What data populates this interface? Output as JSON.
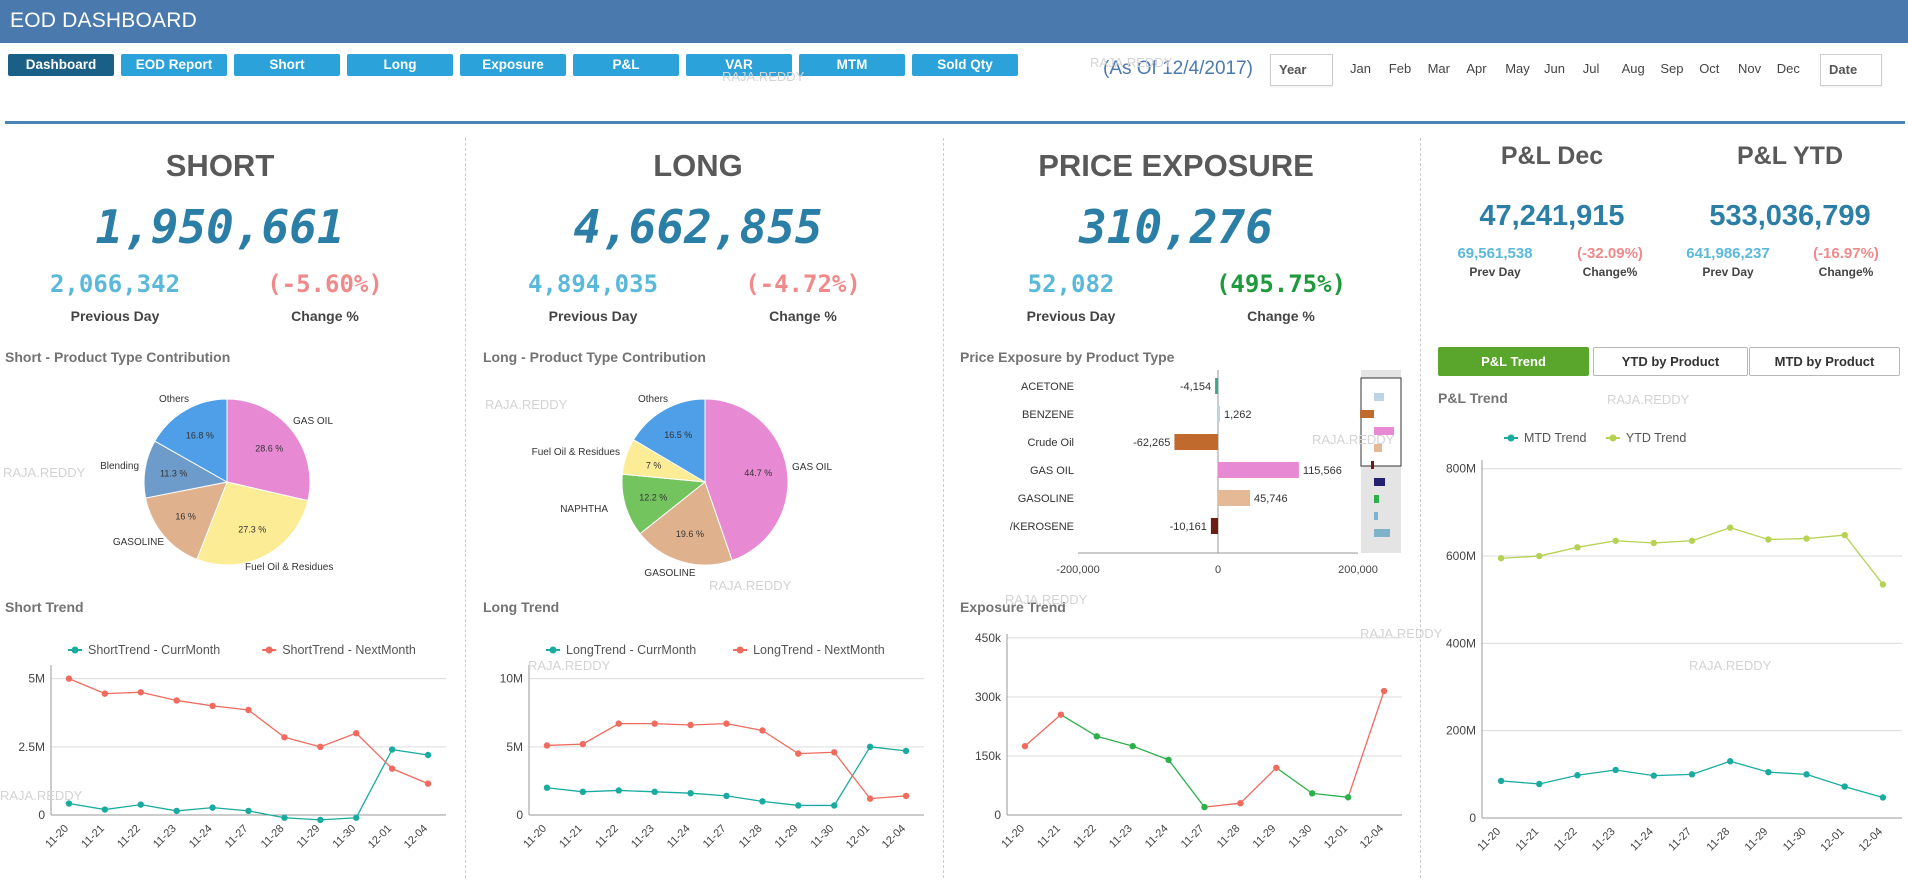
{
  "app": {
    "title": "EOD DASHBOARD"
  },
  "nav": [
    {
      "label": "Dashboard",
      "active": true
    },
    {
      "label": "EOD Report"
    },
    {
      "label": "Short"
    },
    {
      "label": "Long"
    },
    {
      "label": "Exposure"
    },
    {
      "label": "P&L"
    },
    {
      "label": "VAR"
    },
    {
      "label": "MTM"
    },
    {
      "label": "Sold Qty"
    }
  ],
  "asof": "(As Of 12/4/2017)",
  "filters": {
    "year_label": "Year",
    "date_label": "Date",
    "months": [
      "Jan",
      "Feb",
      "Mar",
      "Apr",
      "May",
      "Jun",
      "Jul",
      "Aug",
      "Sep",
      "Oct",
      "Nov",
      "Dec"
    ]
  },
  "watermark": "RAJA.REDDY",
  "kpis": {
    "short": {
      "title": "SHORT",
      "value": "1,950,661",
      "prev": "2,066,342",
      "prev_label": "Previous Day",
      "change": "(-5.60%)",
      "change_label": "Change %",
      "change_color": "#f08a8a"
    },
    "long": {
      "title": "LONG",
      "value": "4,662,855",
      "prev": "4,894,035",
      "prev_label": "Previous Day",
      "change": "(-4.72%)",
      "change_label": "Change %",
      "change_color": "#f08a8a"
    },
    "exposure": {
      "title": "PRICE EXPOSURE",
      "value": "310,276",
      "prev": "52,082",
      "prev_label": "Previous Day",
      "change": "(495.75%)",
      "change_label": "Change %",
      "change_color": "#1e9a3c"
    },
    "pl_dec": {
      "title": "P&L Dec",
      "value": "47,241,915",
      "prev": "69,561,538",
      "prev_label": "Prev Day",
      "change": "(-32.09%)",
      "change_label": "Change%",
      "change_color": "#f08a8a"
    },
    "pl_ytd": {
      "title": "P&L YTD",
      "value": "533,036,799",
      "prev": "641,986,237",
      "prev_label": "Prev Day",
      "change": "(-16.97%)",
      "change_label": "Change%",
      "change_color": "#f08a8a"
    }
  },
  "sections": {
    "short_pie": "Short - Product Type Contribution",
    "long_pie": "Long - Product Type Contribution",
    "exposure_bar": "Price Exposure by Product Type",
    "short_trend": "Short Trend",
    "long_trend": "Long Trend",
    "exposure_trend": "Exposure Trend",
    "pl_trend": "P&L Trend"
  },
  "pl_tabs": [
    {
      "label": "P&L Trend",
      "active": true
    },
    {
      "label": "YTD by Product"
    },
    {
      "label": "MTD by Product"
    }
  ],
  "colors": {
    "teal": "#1aaba0",
    "salmon": "#f06b5e",
    "green": "#2bb04a",
    "lime": "#b5d253",
    "kpi_blue": "#2b7ea5",
    "light_blue": "#5ab9da"
  },
  "chart_data": [
    {
      "id": "short_pie",
      "type": "pie",
      "slices": [
        {
          "label": "GAS OIL",
          "value": 28.6,
          "pct_label": "28.6 %",
          "color": "#e88ad3"
        },
        {
          "label": "Fuel Oil & Residues",
          "value": 27.3,
          "pct_label": "27.3 %",
          "color": "#fdec96"
        },
        {
          "label": "GASOLINE",
          "value": 16.0,
          "pct_label": "16 %",
          "color": "#e0b18d"
        },
        {
          "label": "Blending",
          "value": 11.3,
          "pct_label": "11.3 %",
          "color": "#6e9cca"
        },
        {
          "label": "Others",
          "value": 16.8,
          "pct_label": "16.8 %",
          "color": "#4e9ee8"
        }
      ]
    },
    {
      "id": "long_pie",
      "type": "pie",
      "slices": [
        {
          "label": "GAS OIL",
          "value": 44.7,
          "pct_label": "44.7 %",
          "color": "#e88ad3"
        },
        {
          "label": "GASOLINE",
          "value": 19.6,
          "pct_label": "19.6 %",
          "color": "#e0b18d"
        },
        {
          "label": "NAPHTHA",
          "value": 12.2,
          "pct_label": "12.2 %",
          "color": "#73c35e"
        },
        {
          "label": "Fuel Oil & Residues",
          "value": 7.0,
          "pct_label": "7 %",
          "color": "#fdec96"
        },
        {
          "label": "Others",
          "value": 16.5,
          "pct_label": "16.5 %",
          "color": "#4e9ee8"
        }
      ]
    },
    {
      "id": "exposure_bar",
      "type": "bar",
      "orientation": "horizontal",
      "categories": [
        "ACETONE",
        "BENZENE",
        "Crude Oil",
        "GAS OIL",
        "GASOLINE",
        "JET/KEROSENE"
      ],
      "values": [
        -4154,
        1262,
        -62265,
        115566,
        45746,
        -10161
      ],
      "value_labels": [
        "-4,154",
        "1,262",
        "-62,265",
        "115,566",
        "45,746",
        "-10,161"
      ],
      "colors": [
        "#3aa88c",
        "#bcd4e6",
        "#c06a2e",
        "#e88ad3",
        "#e5b896",
        "#6a1e14"
      ],
      "xlim": [
        -200000,
        200000
      ],
      "xticks": [
        "-200,000",
        "0",
        "200,000"
      ]
    },
    {
      "id": "short_trend",
      "type": "line",
      "x": [
        "11-20",
        "11-21",
        "11-22",
        "11-23",
        "11-24",
        "11-27",
        "11-28",
        "11-29",
        "11-30",
        "12-01",
        "12-04"
      ],
      "series": [
        {
          "name": "ShortTrend - CurrMonth",
          "color": "#1aaba0",
          "values": [
            0.42,
            0.2,
            0.38,
            0.15,
            0.27,
            0.15,
            -0.1,
            -0.18,
            -0.1,
            2.4,
            2.2
          ]
        },
        {
          "name": "ShortTrend - NextMonth",
          "color": "#f06b5e",
          "values": [
            5.0,
            4.45,
            4.5,
            4.2,
            4.0,
            3.85,
            2.85,
            2.5,
            3.0,
            1.7,
            1.15
          ]
        }
      ],
      "ylim": [
        0,
        5.5
      ],
      "yticks": [
        {
          "v": 0,
          "label": "0"
        },
        {
          "v": 2.5,
          "label": "2.5M"
        },
        {
          "v": 5,
          "label": "5M"
        }
      ]
    },
    {
      "id": "long_trend",
      "type": "line",
      "x": [
        "11-20",
        "11-21",
        "11-22",
        "11-23",
        "11-24",
        "11-27",
        "11-28",
        "11-29",
        "11-30",
        "12-01",
        "12-04"
      ],
      "series": [
        {
          "name": "LongTrend - CurrMonth",
          "color": "#1aaba0",
          "values": [
            2.0,
            1.7,
            1.8,
            1.7,
            1.6,
            1.4,
            1.0,
            0.7,
            0.7,
            5.0,
            4.7
          ]
        },
        {
          "name": "LongTrend - NextMonth",
          "color": "#f06b5e",
          "values": [
            5.1,
            5.2,
            6.7,
            6.7,
            6.6,
            6.7,
            6.2,
            4.5,
            4.6,
            1.2,
            1.4
          ]
        }
      ],
      "ylim": [
        0,
        11
      ],
      "yticks": [
        {
          "v": 0,
          "label": "0"
        },
        {
          "v": 5,
          "label": "5M"
        },
        {
          "v": 10,
          "label": "10M"
        }
      ]
    },
    {
      "id": "exposure_trend",
      "type": "line",
      "x": [
        "11-20",
        "11-21",
        "11-22",
        "11-23",
        "11-24",
        "11-27",
        "11-28",
        "11-29",
        "11-30",
        "12-01",
        "12-04"
      ],
      "values": [
        175,
        255,
        200,
        175,
        140,
        20,
        30,
        120,
        55,
        45,
        315
      ],
      "ylim": [
        0,
        460
      ],
      "yticks": [
        {
          "v": 0,
          "label": "0"
        },
        {
          "v": 150,
          "label": "150k"
        },
        {
          "v": 300,
          "label": "300k"
        },
        {
          "v": 450,
          "label": "450k"
        }
      ]
    },
    {
      "id": "pl_trend",
      "type": "line",
      "x": [
        "11-20",
        "11-21",
        "11-22",
        "11-23",
        "11-24",
        "11-27",
        "11-28",
        "11-29",
        "11-30",
        "12-01",
        "12-04"
      ],
      "series": [
        {
          "name": "MTD Trend",
          "color": "#1aaba0",
          "values": [
            85,
            78,
            98,
            110,
            97,
            100,
            130,
            105,
            100,
            72,
            47
          ]
        },
        {
          "name": "YTD Trend",
          "color": "#b5d253",
          "values": [
            595,
            600,
            620,
            635,
            630,
            635,
            665,
            638,
            640,
            648,
            535
          ]
        }
      ],
      "ylim": [
        0,
        820
      ],
      "yticks": [
        {
          "v": 0,
          "label": "0"
        },
        {
          "v": 200,
          "label": "200M"
        },
        {
          "v": 400,
          "label": "400M"
        },
        {
          "v": 600,
          "label": "600M"
        },
        {
          "v": 800,
          "label": "800M"
        }
      ]
    }
  ]
}
